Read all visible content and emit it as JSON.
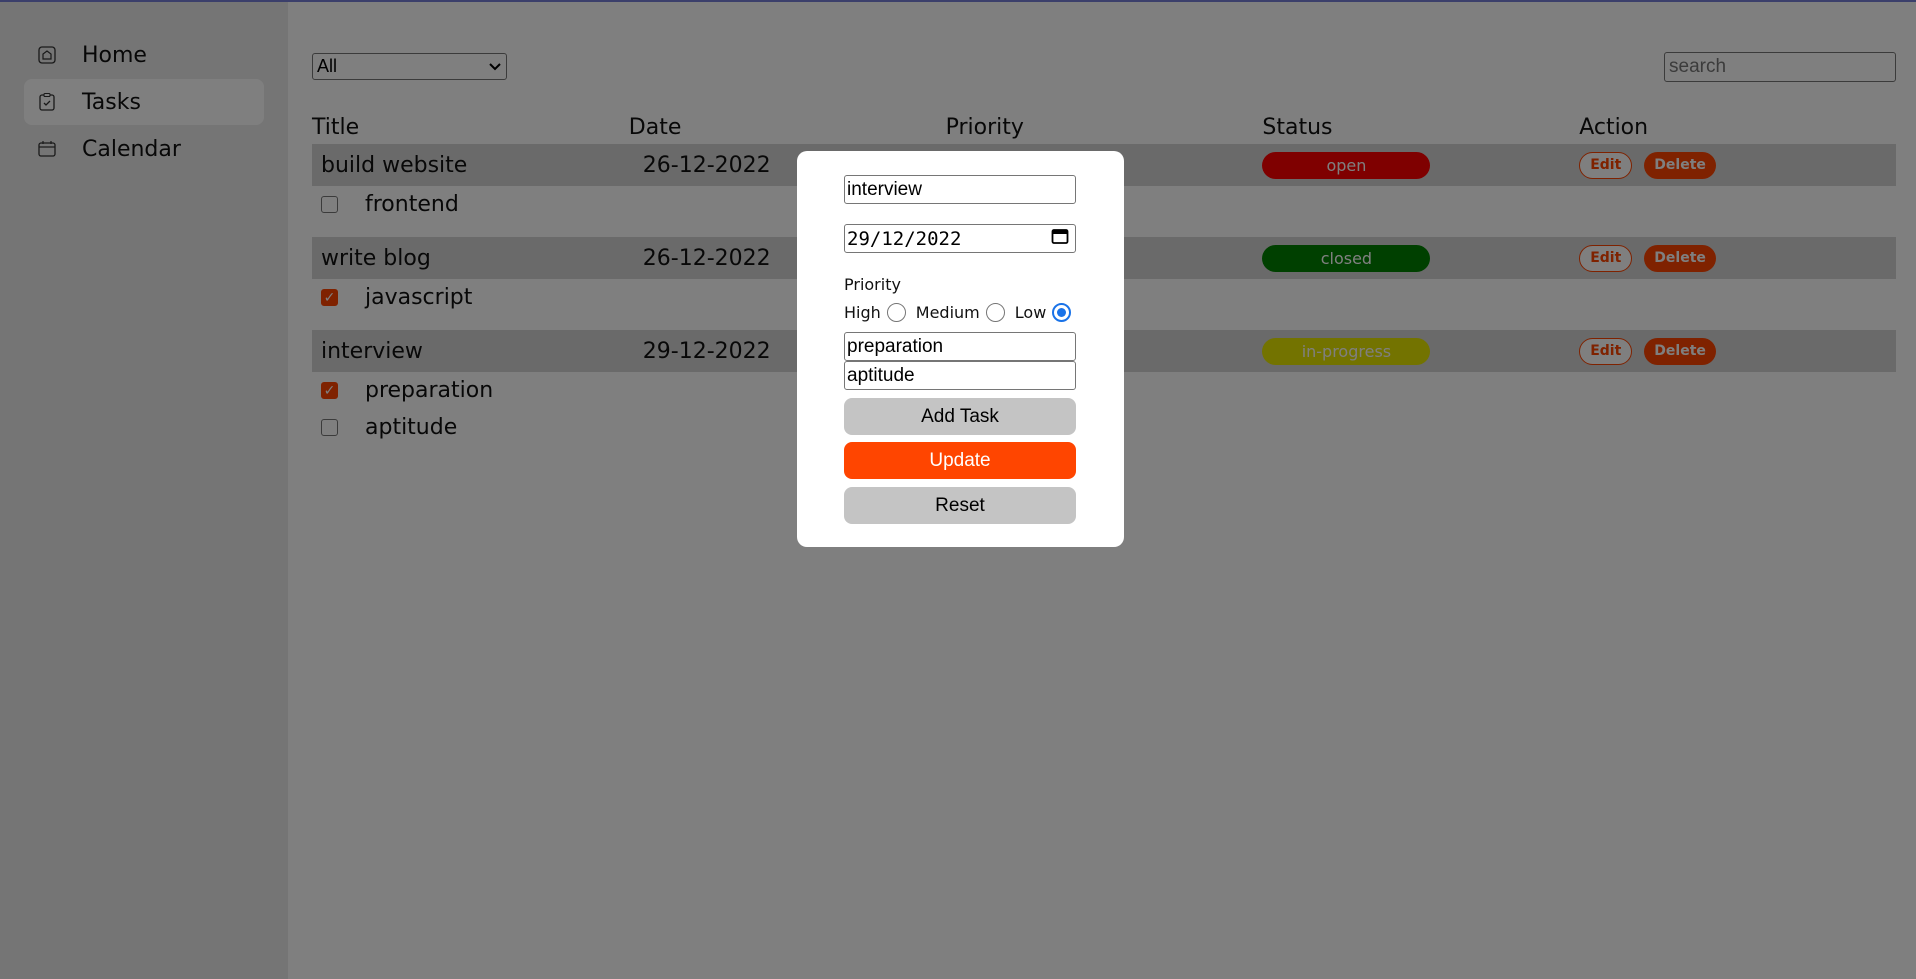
{
  "sidebar": {
    "items": [
      {
        "label": "Home",
        "icon": "home-icon"
      },
      {
        "label": "Tasks",
        "icon": "clipboard-check-icon",
        "active": true
      },
      {
        "label": "Calendar",
        "icon": "calendar-icon"
      }
    ]
  },
  "filter": {
    "selected": "All"
  },
  "search": {
    "placeholder": "search"
  },
  "table": {
    "headers": [
      "Title",
      "Date",
      "Priority",
      "Status",
      "Action"
    ],
    "tasks": [
      {
        "title": "build website",
        "date": "26-12-2022",
        "status": "open",
        "status_color": "#ff0000",
        "subtasks": [
          {
            "label": "frontend",
            "checked": false
          }
        ]
      },
      {
        "title": "write blog",
        "date": "26-12-2022",
        "status": "closed",
        "status_color": "#008000",
        "subtasks": [
          {
            "label": "javascript",
            "checked": true
          }
        ]
      },
      {
        "title": "interview",
        "date": "29-12-2022",
        "status": "in-progress",
        "status_color": "#e6e600",
        "subtasks": [
          {
            "label": "preparation",
            "checked": true
          },
          {
            "label": "aptitude",
            "checked": false
          }
        ]
      }
    ],
    "edit_label": "Edit",
    "delete_label": "Delete"
  },
  "modal": {
    "title_value": "interview",
    "date_value": "29/12/2022",
    "priority_label": "Priority",
    "priority_options": [
      "High",
      "Medium",
      "Low"
    ],
    "priority_selected": "Low",
    "subtask_values": [
      "preparation",
      "aptitude"
    ],
    "add_task_label": "Add Task",
    "update_label": "Update",
    "reset_label": "Reset"
  },
  "colors": {
    "accent": "#ff4500",
    "sidebar_bg": "#ebebeb",
    "row_bg": "#d4d4d4"
  }
}
